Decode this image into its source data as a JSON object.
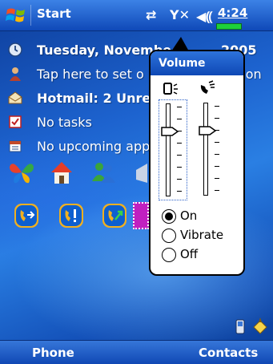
{
  "topbar": {
    "start_label": "Start",
    "clock": "4:24",
    "icons": [
      "connectivity-icon",
      "signal-off-icon",
      "speaker-icon"
    ]
  },
  "today": {
    "rows": [
      {
        "icon": "clock-icon",
        "text": "Tuesday, Novembe",
        "tail": "2005"
      },
      {
        "icon": "owner-icon",
        "text": "Tap here to set o",
        "tail": "tion"
      },
      {
        "icon": "mail-icon",
        "text": "Hotmail: 2 Unre"
      },
      {
        "icon": "tasks-icon",
        "text": "No tasks"
      },
      {
        "icon": "calendar-icon",
        "text": "No upcoming app"
      }
    ]
  },
  "volume": {
    "title": "Volume",
    "system_level": 0.72,
    "ringer_level": 0.72,
    "options": [
      {
        "label": "On",
        "selected": true
      },
      {
        "label": "Vibrate",
        "selected": false
      },
      {
        "label": "Off",
        "selected": false
      }
    ]
  },
  "softkeys": {
    "left": "Phone",
    "right": "Contacts"
  },
  "colors": {
    "bar_top": "#3c82e6",
    "bar_bottom": "#0f49b8",
    "battery": "#1ed03a"
  }
}
